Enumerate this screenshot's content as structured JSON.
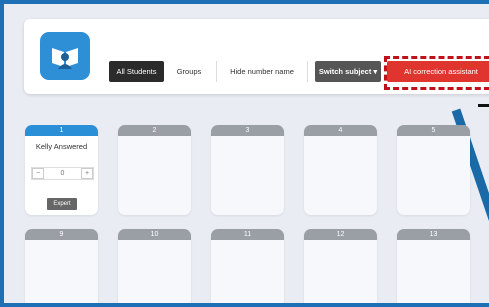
{
  "toolbar": {
    "all_students": "All Students",
    "groups": "Groups",
    "hide_number_name": "Hide number name",
    "switch_subject": "Switch subject ▾",
    "ai_assistant": "AI correction assistant"
  },
  "colors": {
    "accent": "#2b8fd8",
    "frame": "#1f6fb5",
    "ai_button": "#e0342f"
  },
  "icons": {
    "logo": "book-reader-icon"
  },
  "active_card": {
    "number": "1",
    "name": "Kelly Answered",
    "stepper_minus": "−",
    "stepper_value": "0",
    "stepper_plus": "+",
    "button": "Expert"
  },
  "cards": [
    {
      "number": "2"
    },
    {
      "number": "3"
    },
    {
      "number": "4"
    },
    {
      "number": "5"
    },
    {
      "number": "9"
    },
    {
      "number": "10"
    },
    {
      "number": "11"
    },
    {
      "number": "12"
    },
    {
      "number": "13"
    }
  ]
}
